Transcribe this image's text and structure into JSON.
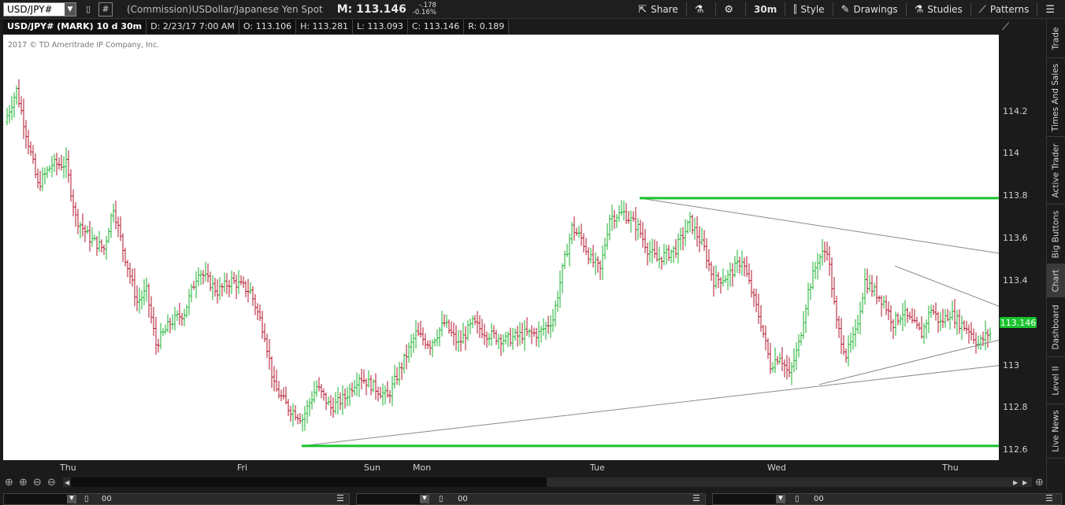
{
  "header": {
    "symbol": "USD/JPY#",
    "description": "(Commission)USDollar/Japanese Yen Spot",
    "mark": "M: 113.146",
    "change": "-.178",
    "change_pct": "-0.16%",
    "timeframe": "30m",
    "share_label": "Share",
    "style_label": "Style",
    "drawings_label": "Drawings",
    "studies_label": "Studies",
    "patterns_label": "Patterns"
  },
  "info": {
    "symbol": "USD/JPY# (MARK) 10 d 30m",
    "date": "D: 2/23/17 7:00 AM",
    "open": "O: 113.106",
    "high": "H: 113.281",
    "low": "L: 113.093",
    "close": "C: 113.146",
    "range": "R: 0.189"
  },
  "copyright": "2017 © TD Ameritrade IP Company, Inc.",
  "price_tag": "113.146",
  "sidebar": [
    "Trade",
    "Times And Sales",
    "Active Trader",
    "Big Buttons",
    "Chart",
    "Dashboard",
    "Level II",
    "Live News"
  ],
  "sidebar_active": "Chart",
  "panels": [
    {
      "value": "00"
    },
    {
      "value": "00"
    },
    {
      "value": "00"
    }
  ],
  "colors": {
    "up": "#19b22e",
    "down": "#b0132a",
    "level": "#19c32d",
    "trend": "#8a8a8a"
  },
  "chart_data": {
    "type": "ohlc",
    "title": "USD/JPY# (MARK) 10 d 30m",
    "ylim": [
      112.6,
      114.4
    ],
    "yticks": [
      "114.2",
      "114",
      "113.8",
      "113.6",
      "113.4",
      "113.2",
      "113",
      "112.8",
      "112.6"
    ],
    "xticks": [
      "Thu",
      "Fri",
      "Sun",
      "Mon",
      "Tue",
      "Wed",
      "Thu"
    ],
    "anchors": [
      [
        0,
        114.15
      ],
      [
        5,
        114.3
      ],
      [
        10,
        114.05
      ],
      [
        14,
        113.85
      ],
      [
        20,
        113.95
      ],
      [
        26,
        113.95
      ],
      [
        30,
        113.7
      ],
      [
        36,
        113.6
      ],
      [
        42,
        113.55
      ],
      [
        46,
        113.75
      ],
      [
        50,
        113.55
      ],
      [
        56,
        113.3
      ],
      [
        60,
        113.35
      ],
      [
        64,
        113.1
      ],
      [
        70,
        113.2
      ],
      [
        76,
        113.25
      ],
      [
        82,
        113.45
      ],
      [
        90,
        113.35
      ],
      [
        96,
        113.4
      ],
      [
        104,
        113.35
      ],
      [
        110,
        113.15
      ],
      [
        114,
        112.9
      ],
      [
        120,
        112.8
      ],
      [
        126,
        112.75
      ],
      [
        132,
        112.9
      ],
      [
        138,
        112.8
      ],
      [
        144,
        112.85
      ],
      [
        150,
        112.95
      ],
      [
        156,
        112.9
      ],
      [
        162,
        112.85
      ],
      [
        168,
        113.0
      ],
      [
        174,
        113.15
      ],
      [
        180,
        113.1
      ],
      [
        186,
        113.2
      ],
      [
        192,
        113.1
      ],
      [
        198,
        113.2
      ],
      [
        204,
        113.15
      ],
      [
        212,
        113.12
      ],
      [
        220,
        113.15
      ],
      [
        226,
        113.15
      ],
      [
        232,
        113.22
      ],
      [
        236,
        113.45
      ],
      [
        240,
        113.65
      ],
      [
        244,
        113.6
      ],
      [
        248,
        113.5
      ],
      [
        252,
        113.45
      ],
      [
        256,
        113.7
      ],
      [
        262,
        113.72
      ],
      [
        268,
        113.65
      ],
      [
        272,
        113.55
      ],
      [
        276,
        113.5
      ],
      [
        284,
        113.55
      ],
      [
        290,
        113.68
      ],
      [
        296,
        113.55
      ],
      [
        300,
        113.4
      ],
      [
        306,
        113.42
      ],
      [
        312,
        113.5
      ],
      [
        316,
        113.35
      ],
      [
        320,
        113.2
      ],
      [
        324,
        113.0
      ],
      [
        328,
        113.05
      ],
      [
        332,
        112.95
      ],
      [
        336,
        113.1
      ],
      [
        340,
        113.35
      ],
      [
        344,
        113.5
      ],
      [
        348,
        113.55
      ],
      [
        352,
        113.2
      ],
      [
        356,
        113.05
      ],
      [
        360,
        113.15
      ],
      [
        364,
        113.4
      ],
      [
        368,
        113.35
      ],
      [
        372,
        113.3
      ],
      [
        376,
        113.2
      ],
      [
        380,
        113.25
      ],
      [
        384,
        113.2
      ],
      [
        388,
        113.15
      ],
      [
        392,
        113.27
      ],
      [
        396,
        113.2
      ],
      [
        400,
        113.25
      ],
      [
        404,
        113.2
      ],
      [
        408,
        113.17
      ],
      [
        412,
        113.1
      ],
      [
        416,
        113.15
      ]
    ],
    "bar_count": 417,
    "hlines": [
      {
        "y": 113.79,
        "x_from": 268
      },
      {
        "y": 112.62,
        "x_from": 125
      }
    ],
    "trendlines": [
      [
        [
          125,
          112.62
        ],
        [
          416,
          113.0
        ]
      ],
      [
        [
          344,
          112.91
        ],
        [
          416,
          113.12
        ]
      ],
      [
        [
          268,
          113.79
        ],
        [
          416,
          113.53
        ]
      ],
      [
        [
          376,
          113.47
        ],
        [
          416,
          113.28
        ]
      ]
    ]
  }
}
